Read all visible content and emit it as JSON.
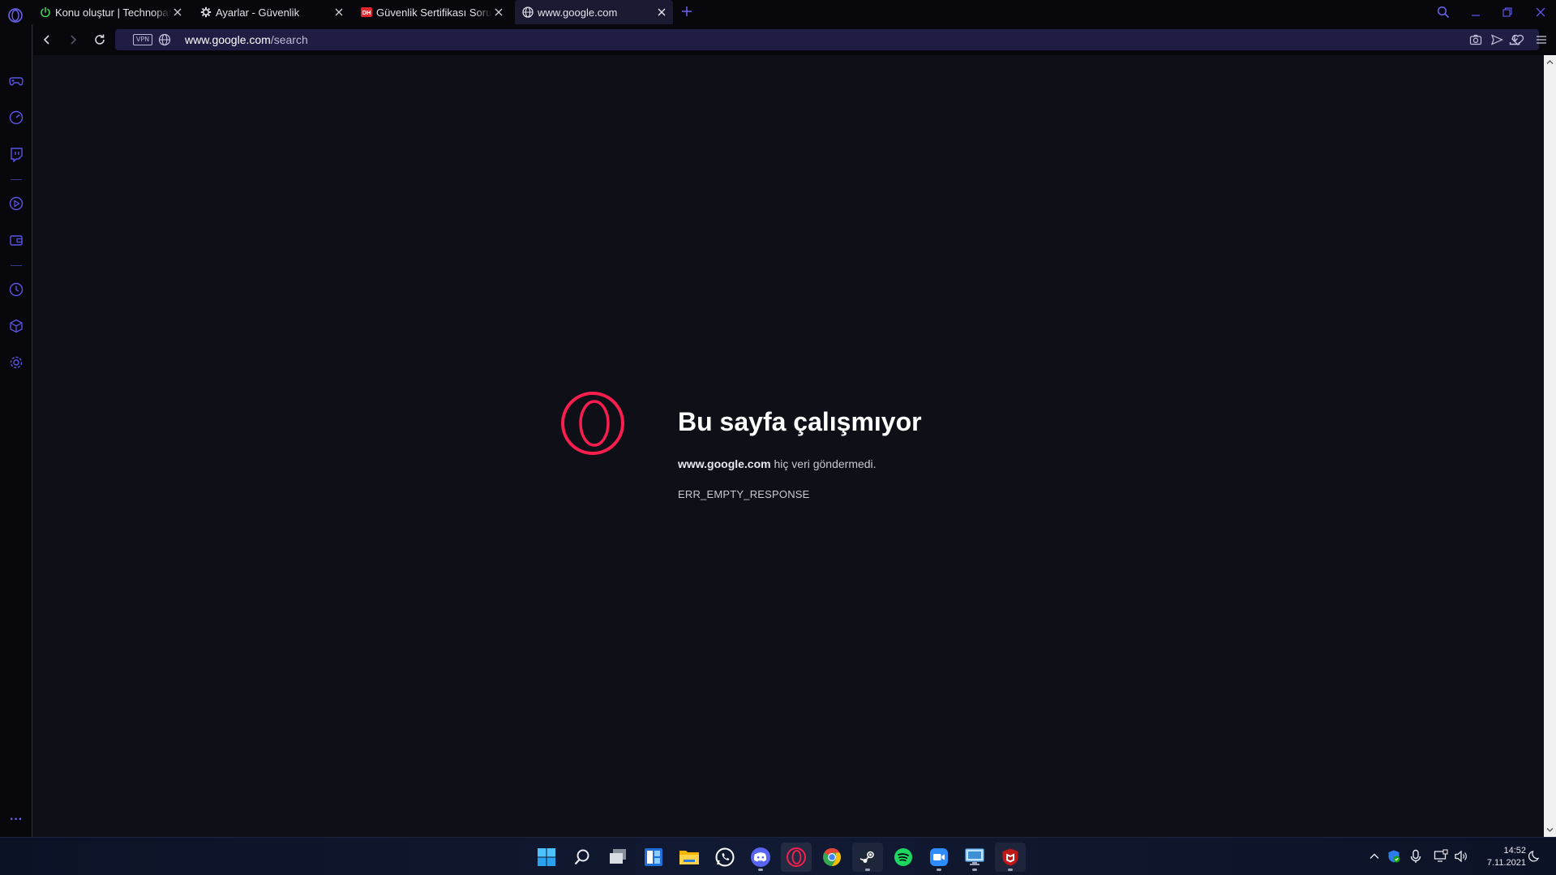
{
  "browser": {
    "tabs": [
      {
        "title": "Konu oluştur | Technopat Sosyal",
        "favicon": "power-icon",
        "active": false
      },
      {
        "title": "Ayarlar - Güvenlik",
        "favicon": "gear-icon",
        "active": false
      },
      {
        "title": "Güvenlik Sertifikası Sorunu",
        "favicon": "dh-icon",
        "active": false
      },
      {
        "title": "www.google.com",
        "favicon": "globe-icon",
        "active": true
      }
    ],
    "address": {
      "vpn_label": "VPN",
      "url_host": "www.google.com",
      "url_path": "/search"
    }
  },
  "sidebar": {
    "items": [
      "gamepad-icon",
      "speed-icon",
      "twitch-icon",
      "player-icon",
      "wallet-icon",
      "history-icon",
      "cube-icon",
      "settings-icon"
    ],
    "more_label": "···"
  },
  "error_page": {
    "title": "Bu sayfa çalışmıyor",
    "host": "www.google.com",
    "message": " hiç veri göndermedi.",
    "code": "ERR_EMPTY_RESPONSE"
  },
  "taskbar": {
    "apps": [
      "start",
      "search",
      "task-view",
      "widgets",
      "file-explorer",
      "whatsapp",
      "discord",
      "opera-gx",
      "chrome",
      "steam",
      "spotify",
      "zoom",
      "remote-desktop",
      "mcafee"
    ],
    "clock": {
      "time": "14:52",
      "date": "7.11.2021"
    }
  },
  "colors": {
    "accent": "#5b55e6",
    "opera_red": "#fa1e4e",
    "background": "#0f0f17"
  }
}
